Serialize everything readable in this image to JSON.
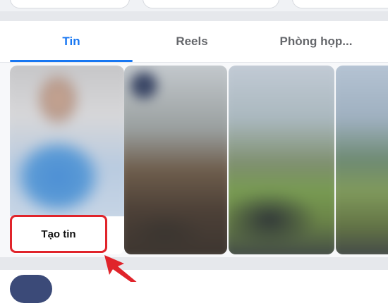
{
  "tabs": [
    {
      "label": "Tin",
      "active": true
    },
    {
      "label": "Reels",
      "active": false
    },
    {
      "label": "Phòng họp...",
      "active": false
    }
  ],
  "create_story": {
    "label": "Tạo tin"
  },
  "colors": {
    "accent": "#1877f2",
    "highlight": "#e0242b",
    "inactive_tab": "#65676b"
  }
}
